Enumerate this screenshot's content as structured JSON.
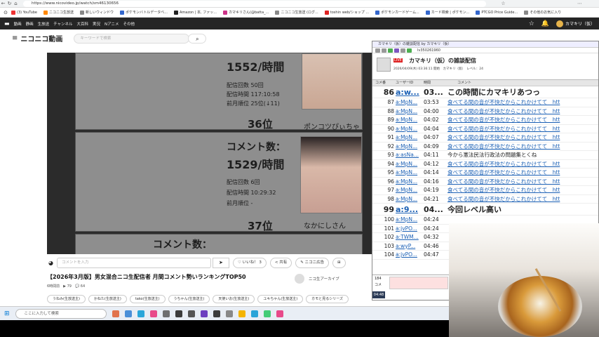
{
  "browser": {
    "url": "https://www.nicovideo.jp/watch/sm46130656",
    "bookmarks": [
      "(3) YouTube",
      "ニコニコ生放送",
      "新しいウィンドウ",
      "ポケモンバトルデータベ...",
      "Amazon | 本, ファッ...",
      "カマキリさん(@batta_...",
      "ニコニコ生放送 (ログ...",
      "toshin web/ショップ ...",
      "ポケモンカードゲーム...",
      "カード検索 | ポケモン...",
      "PTCGO Price Guide...",
      "その他のお気に入り"
    ],
    "colors": {
      "accent": "#252525"
    }
  },
  "nicobar": {
    "links": [
      "動画",
      "静画",
      "生放送",
      "チャンネル",
      "大百科",
      "実況",
      "Nアニメ",
      "その他"
    ],
    "username": "カマキリ（仮）"
  },
  "header": {
    "logo": "ニコニコ動画",
    "search_placeholder": "キーワードで検索"
  },
  "video": {
    "stat1": "1552/時間",
    "stat1_lines": [
      "配信回数 50回",
      "配信時間 117:10:58",
      "前月順位 25位(↓11)"
    ],
    "rank1": "36位",
    "name1": "ポンコツぴぃちゃん",
    "label2": "コメント数：",
    "stat2": "1529/時間",
    "stat2_lines": [
      "配信回数 6回",
      "配信時間 10:29:32",
      "前月順位 -"
    ],
    "rank2": "37位",
    "name2": "なかにしさん",
    "label3": "コメント数："
  },
  "controls": {
    "comment_placeholder": "コメントを入力",
    "like": "いいね！ 3",
    "share": "共有",
    "ad": "ニコニ広告"
  },
  "info": {
    "title": "【2026年3月版】男女混合ニコ生配信者 月間コメント勢いランキングTOP50",
    "meta": "6時間前　▶ 79　💬 64",
    "channel": "ニコ生アーカイブ",
    "tags": [
      "うねみ(生放送主)",
      "かねた(生放送主)",
      "tako(生放送主)",
      "うちゃん(生放送主)",
      "天使いお(生放送主)",
      "ユキちゃん(生放送主)",
      "ホモと見るシリーズ"
    ]
  },
  "viewer": {
    "window_title": "カマキリ（仮）の雑談配信 by カマキリ（仮）",
    "live_id": "lv350261960",
    "broadcast_title": "カマキリ（仮）の雑談配信",
    "broadcast_meta": "2026/04/09(木) 03:36:11 開始　カマキリ（仮）　レベル：24",
    "headers": [
      "コメ番",
      "ユーザーID",
      "時間",
      "コメント"
    ],
    "rows": [
      {
        "no": "86",
        "user": "a:w...",
        "time": "03...",
        "text": "この時間にカマキリあつっ",
        "big": true,
        "link": false
      },
      {
        "no": "87",
        "user": "a:MpN...",
        "time": "03:53",
        "text": "食べてる間の音が不快だからこれかけてて　htt",
        "big": false,
        "link": true
      },
      {
        "no": "88",
        "user": "a:MpN...",
        "time": "04:00",
        "text": "食べてる間の音が不快だからこれかけてて　htt",
        "big": false,
        "link": true
      },
      {
        "no": "89",
        "user": "a:MpN...",
        "time": "04:02",
        "text": "食べてる間の音が不快だからこれかけてて　htt",
        "big": false,
        "link": true
      },
      {
        "no": "90",
        "user": "a:MpN...",
        "time": "04:04",
        "text": "食べてる間の音が不快だからこれかけてて　htt",
        "big": false,
        "link": true
      },
      {
        "no": "91",
        "user": "a:MpN...",
        "time": "04:07",
        "text": "食べてる間の音が不快だからこれかけてて　htt",
        "big": false,
        "link": true
      },
      {
        "no": "92",
        "user": "a:MpN...",
        "time": "04:09",
        "text": "食べてる間の音が不快だからこれかけてて　htt",
        "big": false,
        "link": true
      },
      {
        "no": "93",
        "user": "a:asNa...",
        "time": "04:11",
        "text": "今から憲法民法行政法の問題集とくね",
        "big": false,
        "link": false
      },
      {
        "no": "94",
        "user": "a:MpN...",
        "time": "04:12",
        "text": "食べてる間の音が不快だからこれかけてて　htt",
        "big": false,
        "link": true
      },
      {
        "no": "95",
        "user": "a:MpN...",
        "time": "04:14",
        "text": "食べてる間の音が不快だからこれかけてて　htt",
        "big": false,
        "link": true
      },
      {
        "no": "96",
        "user": "a:MpN...",
        "time": "04:16",
        "text": "食べてる間の音が不快だからこれかけてて　htt",
        "big": false,
        "link": true
      },
      {
        "no": "97",
        "user": "a:MpN...",
        "time": "04:19",
        "text": "食べてる間の音が不快だからこれかけてて　htt",
        "big": false,
        "link": true
      },
      {
        "no": "98",
        "user": "a:MpN...",
        "time": "04:21",
        "text": "食べてる間の音が不快だからこれかけてて　htt",
        "big": false,
        "link": true
      },
      {
        "no": "99",
        "user": "a:9...",
        "time": "04...",
        "text": "今回レベル高い",
        "big": true,
        "link": false
      },
      {
        "no": "100",
        "user": "a:MpN...",
        "time": "04:24",
        "text": "",
        "big": false,
        "link": false
      },
      {
        "no": "101",
        "user": "a:jvPO...",
        "time": "04:24",
        "text": "",
        "big": false,
        "link": false
      },
      {
        "no": "102",
        "user": "a:TWM...",
        "time": "04:32",
        "text": "",
        "big": false,
        "link": false
      },
      {
        "no": "103",
        "user": "a:wyP...",
        "time": "04:46",
        "text": "",
        "big": false,
        "link": false
      },
      {
        "no": "104",
        "user": "a:jvPO...",
        "time": "04:47",
        "text": "",
        "big": false,
        "link": false
      }
    ],
    "elapsed": "04:48",
    "options": [
      "184",
      "コメ"
    ]
  },
  "taskbar": {
    "search_placeholder": "ここに入力して検索"
  }
}
